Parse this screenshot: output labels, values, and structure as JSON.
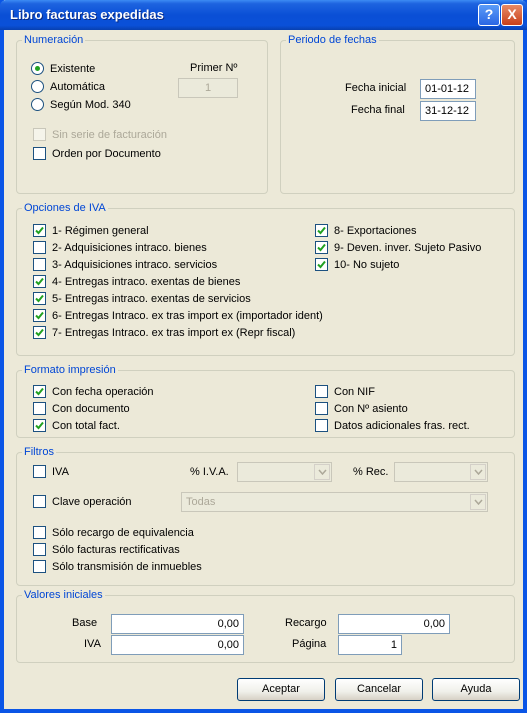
{
  "window": {
    "title": "Libro facturas expedidas",
    "help_label": "?",
    "close_label": "X"
  },
  "numeracion": {
    "legend": "Numeración",
    "existente": "Existente",
    "automatica": "Automática",
    "segun": "Según Mod. 340",
    "primer_label": "Primer Nº",
    "primer_value": "1",
    "sin_serie": "Sin serie de facturación",
    "orden": "Orden por Documento",
    "selected": "Existente"
  },
  "periodo": {
    "legend": "Periodo de fechas",
    "inicial_label": "Fecha inicial",
    "inicial_value": "01-01-12",
    "final_label": "Fecha final",
    "final_value": "31-12-12"
  },
  "iva": {
    "legend": "Opciones de IVA",
    "items": [
      {
        "label": "1- Régimen general",
        "checked": true
      },
      {
        "label": "2- Adquisiciones intraco. bienes",
        "checked": false
      },
      {
        "label": "3- Adquisiciones intraco. servicios",
        "checked": false
      },
      {
        "label": "4- Entregas intraco. exentas de bienes",
        "checked": true
      },
      {
        "label": "5- Entregas intraco. exentas de servicios",
        "checked": true
      },
      {
        "label": "6- Entregas Intraco. ex tras import ex (importador ident)",
        "checked": true
      },
      {
        "label": "7- Entregas Intraco. ex tras import ex (Repr fiscal)",
        "checked": true
      },
      {
        "label": "8- Exportaciones",
        "checked": true
      },
      {
        "label": "9- Deven. inver. Sujeto Pasivo",
        "checked": true
      },
      {
        "label": "10- No sujeto",
        "checked": true
      }
    ]
  },
  "formato": {
    "legend": "Formato impresión",
    "items": [
      {
        "label": "Con fecha operación",
        "checked": true
      },
      {
        "label": "Con documento",
        "checked": false
      },
      {
        "label": "Con total fact.",
        "checked": true
      },
      {
        "label": "Con NIF",
        "checked": false
      },
      {
        "label": "Con Nº asiento",
        "checked": false
      },
      {
        "label": "Datos adicionales fras. rect.",
        "checked": false
      }
    ]
  },
  "filtros": {
    "legend": "Filtros",
    "iva_label": "IVA",
    "pct_iva_label": "% I.V.A.",
    "pct_rec_label": "% Rec.",
    "clave_label": "Clave operación",
    "clave_value": "Todas",
    "recargo_label": "Sólo recargo de equivalencia",
    "rectificativas_label": "Sólo facturas rectificativas",
    "inmuebles_label": "Sólo transmisión de inmuebles"
  },
  "valores": {
    "legend": "Valores iniciales",
    "base_label": "Base",
    "base_value": "0,00",
    "iva_label": "IVA",
    "iva_value": "0,00",
    "recargo_label": "Recargo",
    "recargo_value": "0,00",
    "pagina_label": "Página",
    "pagina_value": "1"
  },
  "buttons": {
    "aceptar": "Aceptar",
    "cancelar": "Cancelar",
    "ayuda": "Ayuda"
  },
  "colors": {
    "group_label": "#0046d5",
    "title_bar": "#0a4fd6",
    "check": "#21a121"
  }
}
